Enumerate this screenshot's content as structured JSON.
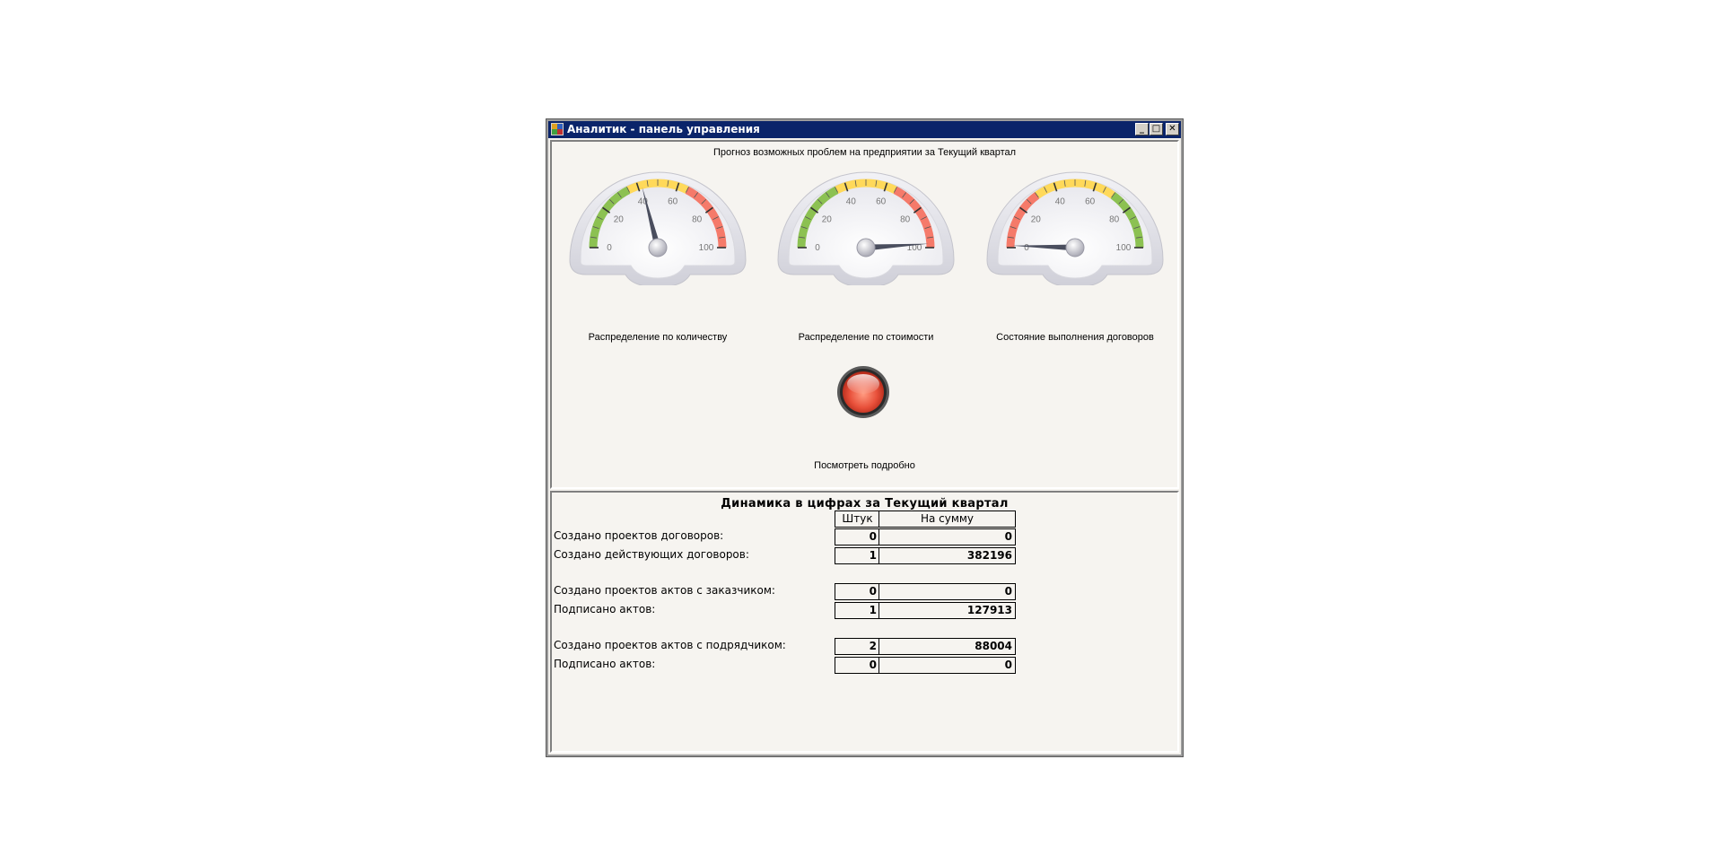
{
  "window": {
    "title": "Аналитик - панель управления",
    "controls": {
      "minimize": "_",
      "maximize": "□",
      "close": "✕"
    },
    "title_bar_color": "#0a246a"
  },
  "forecast": {
    "title": "Прогноз возможных проблем на предприятии за Текущий квартал",
    "gauges": [
      {
        "label": "Распределение по количеству",
        "value": 42,
        "ticks": [
          "0",
          "20",
          "40",
          "60",
          "80",
          "100"
        ],
        "bands": [
          {
            "from": 0,
            "to": 35,
            "color": "#8cc152"
          },
          {
            "from": 35,
            "to": 65,
            "color": "#ffd95a"
          },
          {
            "from": 65,
            "to": 100,
            "color": "#f57a6a"
          }
        ]
      },
      {
        "label": "Распределение по стоимости",
        "value": 98,
        "ticks": [
          "0",
          "20",
          "40",
          "60",
          "80",
          "100"
        ],
        "bands": [
          {
            "from": 0,
            "to": 35,
            "color": "#8cc152"
          },
          {
            "from": 35,
            "to": 65,
            "color": "#ffd95a"
          },
          {
            "from": 65,
            "to": 100,
            "color": "#f57a6a"
          }
        ]
      },
      {
        "label": "Состояние выполнения договоров",
        "value": 1,
        "ticks": [
          "0",
          "20",
          "40",
          "60",
          "80",
          "100"
        ],
        "bands": [
          {
            "from": 0,
            "to": 30,
            "color": "#f57a6a"
          },
          {
            "from": 30,
            "to": 70,
            "color": "#ffd95a"
          },
          {
            "from": 70,
            "to": 100,
            "color": "#8cc152"
          }
        ]
      }
    ],
    "status_light_color": "#e8503a",
    "details_link": "Посмотреть подробно"
  },
  "dynamics": {
    "title": "Динамика  в цифрах за Текущий квартал",
    "headers": {
      "count": "Штук",
      "sum": "На сумму"
    },
    "rows": [
      {
        "label": "Создано проектов договоров:",
        "count": "0",
        "sum": "0"
      },
      {
        "label": "Создано действующих договоров:",
        "count": "1",
        "sum": "382196"
      },
      {
        "label": "Создано проектов актов с заказчиком:",
        "count": "0",
        "sum": "0"
      },
      {
        "label": "Подписано актов:",
        "count": "1",
        "sum": "127913"
      },
      {
        "label": "Создано проектов актов с подрядчиком:",
        "count": "2",
        "sum": "88004"
      },
      {
        "label": "Подписано актов:",
        "count": "0",
        "sum": "0"
      }
    ]
  }
}
